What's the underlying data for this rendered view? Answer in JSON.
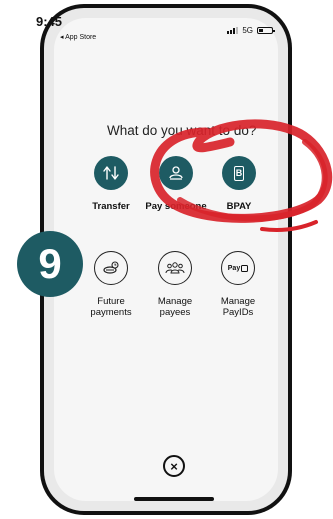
{
  "status": {
    "time": "9:45",
    "back_label": "◂ App Store",
    "network": "5G"
  },
  "heading": "What do you want to do?",
  "actions_primary": [
    {
      "label": "Transfer",
      "icon": "transfer-icon"
    },
    {
      "label": "Pay someone",
      "icon": "person-icon"
    },
    {
      "label": "BPAY",
      "icon": "bpay-icon",
      "icon_text": "B"
    }
  ],
  "actions_secondary": [
    {
      "label": "Future payments",
      "icon": "future-payments-icon"
    },
    {
      "label": "Manage payees",
      "icon": "payees-icon"
    },
    {
      "label": "Manage PayIDs",
      "icon": "payid-icon",
      "icon_text": "Pay"
    }
  ],
  "close_icon": "×",
  "step_badge": "9",
  "colors": {
    "teal": "#1e5b63",
    "scribble_red": "#d8232a"
  }
}
